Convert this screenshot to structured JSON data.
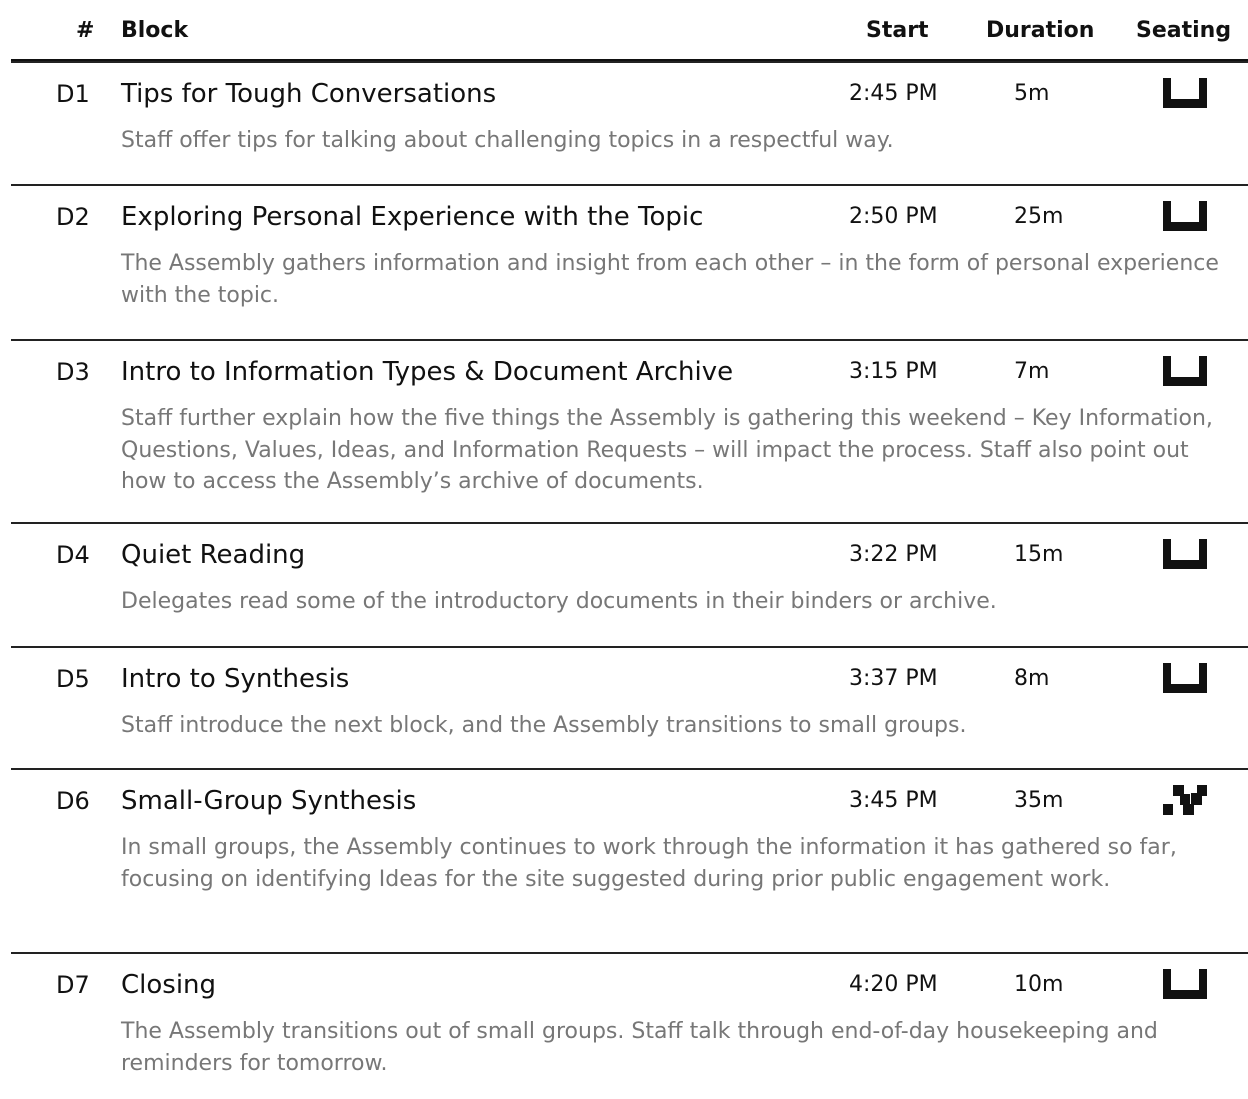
{
  "table": {
    "headers": {
      "num": "#",
      "block": "Block",
      "start": "Start",
      "duration": "Duration",
      "seating": "Seating"
    },
    "rows": [
      {
        "id": "D1",
        "title": "Tips for Tough Conversations",
        "start": "2:45 PM",
        "duration": "5m",
        "seating_icon": "plenary-seating-icon",
        "description": "Staff offer tips for talking about challenging topics in a respectful way."
      },
      {
        "id": "D2",
        "title": "Exploring Personal Experience with the Topic",
        "start": "2:50 PM",
        "duration": "25m",
        "seating_icon": "plenary-seating-icon",
        "description": "The Assembly gathers information and insight from each other – in the form of personal experience with the topic."
      },
      {
        "id": "D3",
        "title": "Intro to Information Types & Document Archive",
        "start": "3:15 PM",
        "duration": "7m",
        "seating_icon": "plenary-seating-icon",
        "description": "Staff further explain how the five things the Assembly is gathering this weekend – Key Information, Questions, Values, Ideas, and Information Requests – will impact the process. Staff also point out how to access the Assembly’s archive of documents."
      },
      {
        "id": "D4",
        "title": "Quiet Reading",
        "start": "3:22 PM",
        "duration": "15m",
        "seating_icon": "plenary-seating-icon",
        "description": "Delegates read some of the introductory documents in their binders or archive."
      },
      {
        "id": "D5",
        "title": "Intro to Synthesis",
        "start": "3:37 PM",
        "duration": "8m",
        "seating_icon": "plenary-seating-icon",
        "description": "Staff introduce the next block, and the Assembly transitions to small groups."
      },
      {
        "id": "D6",
        "title": "Small-Group Synthesis",
        "start": "3:45 PM",
        "duration": "35m",
        "seating_icon": "small-group-seating-icon",
        "description": "In small groups, the Assembly continues to work through the information it has gathered so far, focusing on identifying Ideas for the site suggested during prior public engagement work."
      },
      {
        "id": "D7",
        "title": "Closing",
        "start": "4:20 PM",
        "duration": "10m",
        "seating_icon": "plenary-seating-icon",
        "description": "The Assembly transitions out of small groups. Staff talk through end-of-day housekeeping and reminders for tomorrow."
      }
    ]
  }
}
